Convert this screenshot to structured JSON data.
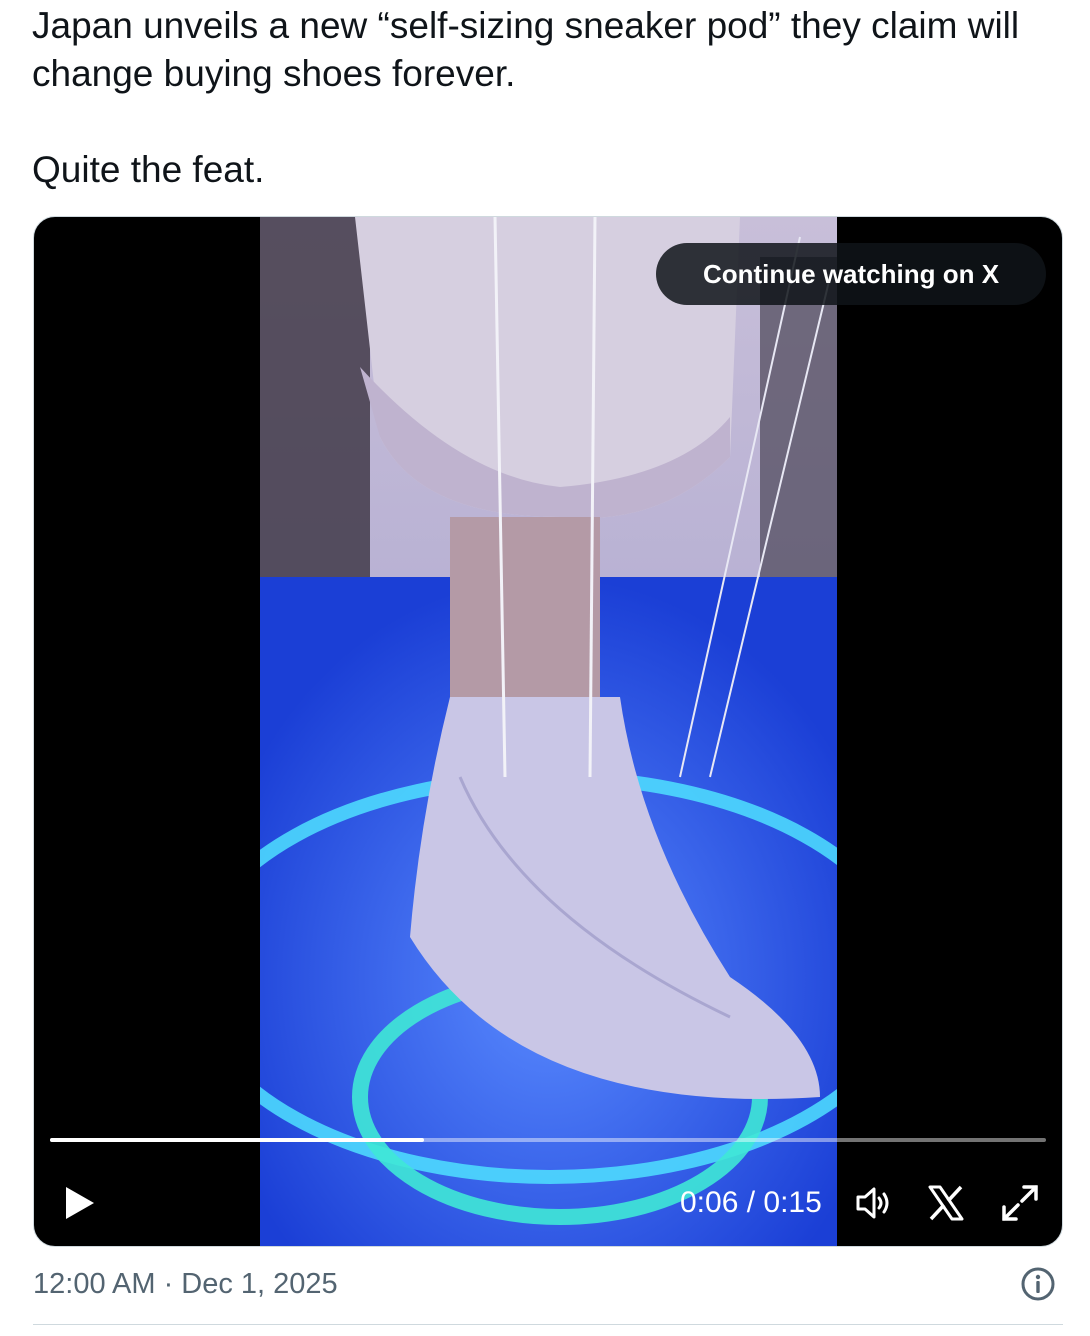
{
  "tweet": {
    "line1": "Japan unveils a new “self-sizing sneaker pod” they claim will change buying shoes forever.",
    "line2": "Quite the feat."
  },
  "video": {
    "continue_label": "Continue watching on X",
    "current_time": "0:06",
    "duration": "0:15",
    "time_display": "0:06 / 0:15",
    "progress": 0.375
  },
  "meta": {
    "timestamp": "12:00 AM · Dec 1, 2025"
  },
  "icons": {
    "play": "play-icon",
    "volume": "volume-icon",
    "x_logo": "x-logo-icon",
    "fullscreen": "fullscreen-icon",
    "info": "info-icon"
  }
}
